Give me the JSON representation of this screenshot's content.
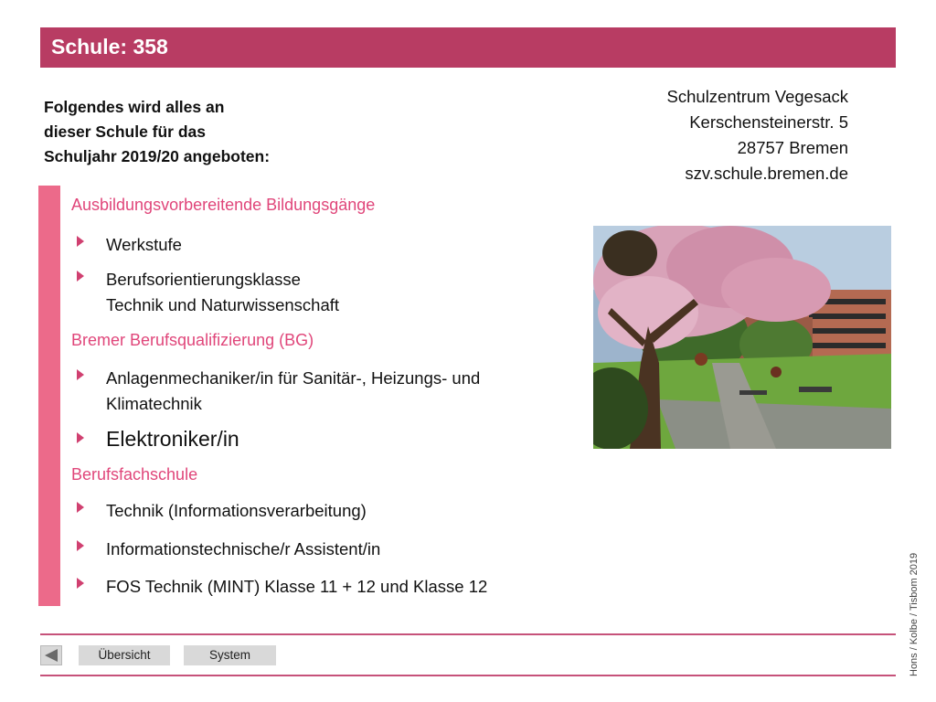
{
  "header": {
    "title": "Schule: 358"
  },
  "intro": {
    "lines": [
      "Folgendes wird alles an",
      "dieser Schule für das",
      "Schuljahr 2019/20 angeboten:"
    ]
  },
  "address": {
    "name": "Schulzentrum Vegesack",
    "street": "Kerschensteinerstr. 5",
    "city": "28757 Bremen",
    "web": "szv.schule.bremen.de"
  },
  "sections": [
    {
      "heading": "Ausbildungsvorbereitende Bildungsgänge",
      "items": [
        {
          "lines": [
            "Werkstufe"
          ]
        },
        {
          "lines": [
            "Berufsorientierungsklasse",
            "Technik und Naturwissenschaft"
          ]
        }
      ]
    },
    {
      "heading": "Bremer Berufsqualifizierung (BG)",
      "items": [
        {
          "lines": [
            "Anlagenmechaniker/in für Sanitär-, Heizungs- und",
            "Klimatechnik"
          ]
        },
        {
          "lines": [
            "Elektroniker/in"
          ]
        }
      ]
    },
    {
      "heading": "Berufsfachschule",
      "items": [
        {
          "lines": [
            "Technik (Informationsverarbeitung)"
          ]
        },
        {
          "lines": [
            "Informationstechnische/r Assistent/in"
          ]
        },
        {
          "lines": [
            "FOS Technik (MINT) Klasse 11 + 12 und Klasse 12"
          ]
        }
      ]
    }
  ],
  "credit": "Hons / Kolbe / Tisbom 2019",
  "nav": {
    "overview_label": "Übersicht",
    "system_label": "System"
  },
  "colors": {
    "title_bar": "#b83c63",
    "accent": "#ec6a8a",
    "heading": "#e0467a"
  },
  "icons": {
    "back": "back-arrow-icon",
    "bullet": "chevron-right-icon"
  }
}
